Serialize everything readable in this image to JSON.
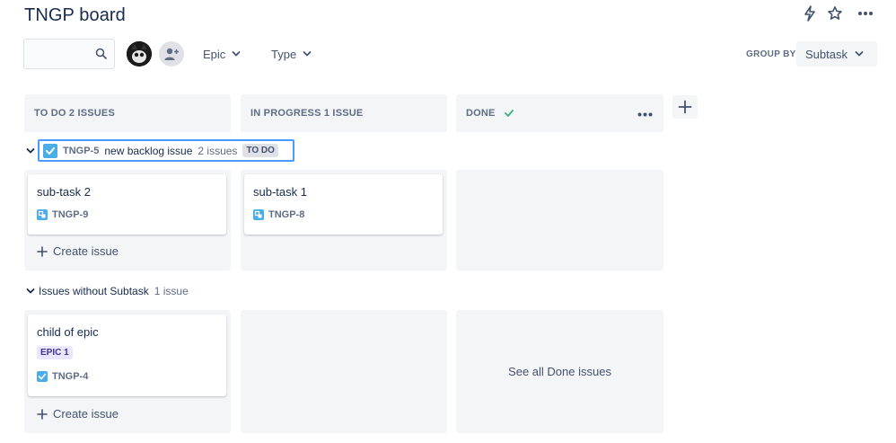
{
  "board": {
    "title": "TNGP board"
  },
  "toolbar": {
    "search_value": "",
    "epic_label": "Epic",
    "type_label": "Type",
    "groupby_label": "GROUP BY",
    "groupby_value": "Subtask"
  },
  "columns": [
    {
      "label": "TO DO 2 ISSUES"
    },
    {
      "label": "IN PROGRESS 1 ISSUE"
    },
    {
      "label": "DONE"
    }
  ],
  "swimlanes": [
    {
      "parent_key": "TNGP-5",
      "parent_summary": "new backlog issue",
      "count": "2 issues",
      "status": "TO DO",
      "cards": [
        {
          "title": "sub-task 2",
          "key": "TNGP-9"
        },
        {
          "title": "sub-task 1",
          "key": "TNGP-8"
        }
      ],
      "create_label": "Create issue"
    },
    {
      "label": "Issues without Subtask",
      "count": "1 issue",
      "cards": [
        {
          "title": "child of epic",
          "epic": "EPIC 1",
          "key": "TNGP-4"
        }
      ],
      "create_label": "Create issue",
      "see_done_label": "See all Done issues"
    }
  ],
  "colors": {
    "accent": "#4c9aff",
    "column_bg": "#f4f5f7",
    "done_check": "#36b37e",
    "issue_icon": "#4bade8",
    "epic_bg": "#eae6ff",
    "epic_text": "#403294"
  },
  "icons": [
    "lightning-icon",
    "star-icon",
    "more-icon",
    "search-icon",
    "add-people-icon",
    "chevron-down-icon",
    "plus-icon",
    "checkbox-icon",
    "subtask-icon",
    "task-icon",
    "check-icon"
  ]
}
